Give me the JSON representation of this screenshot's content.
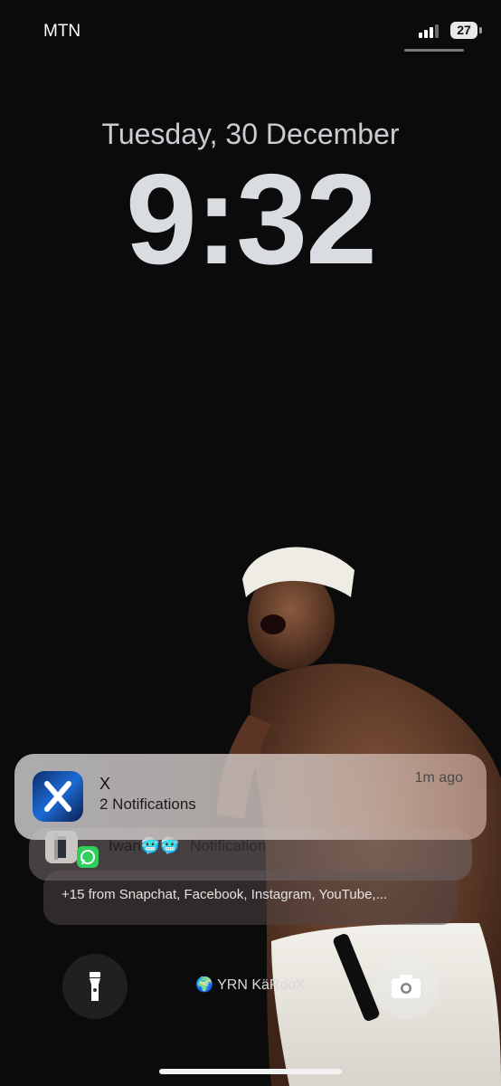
{
  "status_bar": {
    "carrier": "MTN",
    "battery_level": "27",
    "signal_bars": 3
  },
  "lock_screen": {
    "date": "Tuesday, 30 December",
    "time": "9:32",
    "owner_name": "YRN KäRdoX"
  },
  "notifications": {
    "primary": {
      "app": "X",
      "body": "2 Notifications",
      "time": "1m ago",
      "icon": "x-app-icon"
    },
    "secondary": {
      "sender": "Iwan🥶🥶",
      "body": "Notification",
      "icon": "whatsapp-icon"
    },
    "summary": "+15 from Snapchat, Facebook, Instagram, YouTube,..."
  },
  "controls": {
    "flashlight_icon": "flashlight-icon",
    "camera_icon": "camera-icon",
    "globe_icon": "globe-icon"
  },
  "colors": {
    "background": "#0b0b0c",
    "whatsapp_green": "#2fcf5b",
    "x_icon_blue": "#1d6bd6"
  }
}
